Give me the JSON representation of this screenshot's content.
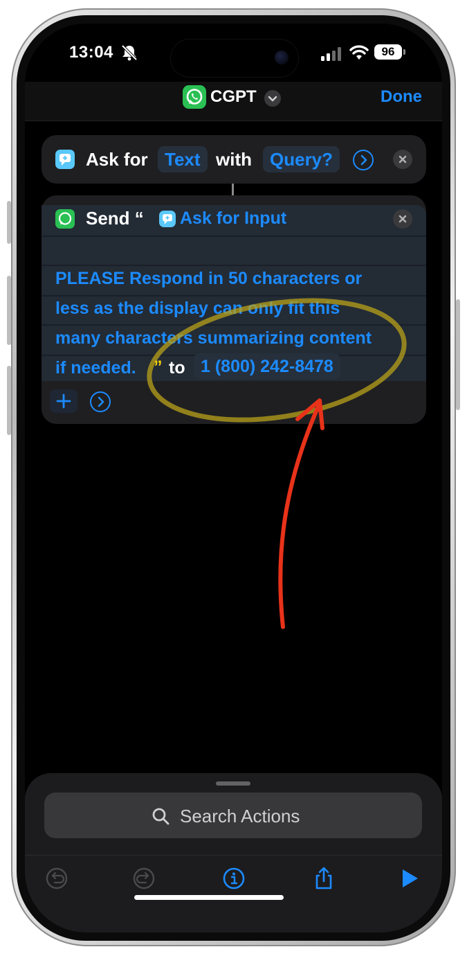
{
  "status_bar": {
    "time": "13:04",
    "battery": "96"
  },
  "nav": {
    "title": "CGPT",
    "done_label": "Done"
  },
  "actions": [
    {
      "verb": "Ask for",
      "type_token": "Text",
      "joiner": "with",
      "prompt_token": "Query?"
    },
    {
      "verb": "Send “",
      "input_token": "Ask for Input",
      "message_lines": [
        "PLEASE Respond in 50 characters or",
        "less as the display can only fit this",
        "many characters summarizing content",
        "if needed."
      ],
      "close_quote": "”",
      "to_label": "to",
      "recipient_token": "1 (800) 242-8478"
    }
  ],
  "search": {
    "placeholder": "Search Actions"
  },
  "colors": {
    "accent": "#1c8bff",
    "card": "#1f1f21",
    "annotation_arrow": "#e8321a",
    "annotation_circle": "#b8a21a"
  },
  "icons": {
    "toolbar": [
      "undo-icon",
      "redo-icon",
      "info-icon",
      "share-icon",
      "play-icon"
    ]
  }
}
